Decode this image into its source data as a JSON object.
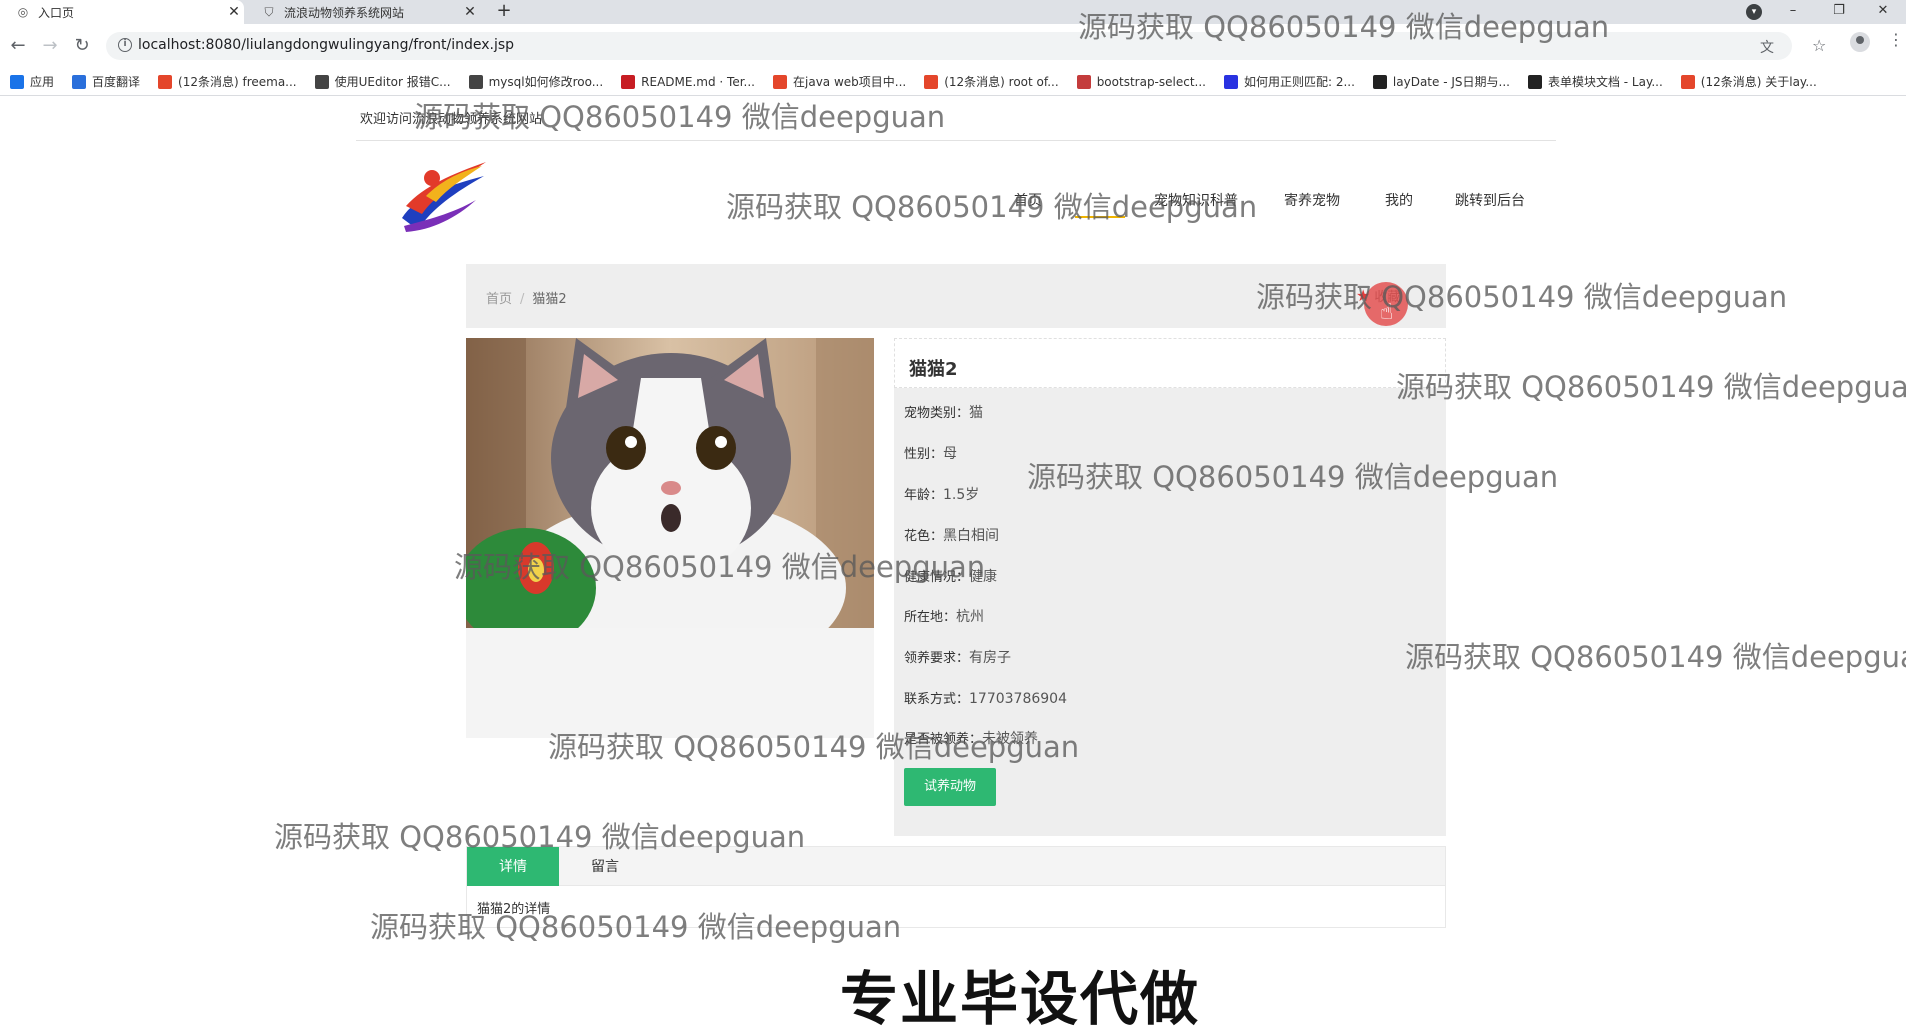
{
  "browser": {
    "tabs": [
      {
        "title": "入口页",
        "active": true
      },
      {
        "title": "流浪动物领养系统网站",
        "active": false
      }
    ],
    "url": "localhost:8080/liulangdongwulingyang/front/index.jsp",
    "bookmarks": [
      {
        "label": "应用",
        "icon": "apps-grid-icon",
        "color": "#1a73e8"
      },
      {
        "label": "百度翻译",
        "icon": "translate-icon",
        "color": "#2a6fdb"
      },
      {
        "label": "(12条消息) freema...",
        "icon": "csdn-icon",
        "color": "#e4462b"
      },
      {
        "label": "使用UEditor 报错C...",
        "icon": "ueditor-icon",
        "color": "#444444"
      },
      {
        "label": "mysql如何修改roo...",
        "icon": "mysql-icon",
        "color": "#444444"
      },
      {
        "label": "README.md · Ter...",
        "icon": "gitee-icon",
        "color": "#c71d23"
      },
      {
        "label": "在java web项目中...",
        "icon": "csdn-icon",
        "color": "#e4462b"
      },
      {
        "label": "(12条消息) root of...",
        "icon": "csdn-icon",
        "color": "#e4462b"
      },
      {
        "label": "bootstrap-select...",
        "icon": "bootstrap-icon",
        "color": "#c43c3c"
      },
      {
        "label": "如何用正则匹配: 2...",
        "icon": "baidu-icon",
        "color": "#2932e1"
      },
      {
        "label": "layDate - JS日期与...",
        "icon": "layui-icon",
        "color": "#222222"
      },
      {
        "label": "表单模块文档 - Lay...",
        "icon": "layui-icon",
        "color": "#222222"
      },
      {
        "label": "(12条消息) 关于lay...",
        "icon": "csdn-icon",
        "color": "#e4462b"
      }
    ]
  },
  "site": {
    "welcome": "欢迎访问流浪动物领养系统网站",
    "nav": [
      {
        "label": "首页"
      },
      {
        "label": "宠物知识科普"
      },
      {
        "label": "寄养宠物"
      },
      {
        "label": "我的"
      },
      {
        "label": "跳转到后台"
      }
    ],
    "breadcrumb": {
      "home": "首页",
      "separator": "/",
      "current": "猫猫2"
    },
    "collect": {
      "label": "收藏",
      "icon": "star-icon"
    },
    "pet": {
      "name": "猫猫2",
      "fields": [
        {
          "key": "宠物类别：",
          "value": "猫"
        },
        {
          "key": "性别：",
          "value": "母"
        },
        {
          "key": "年龄：",
          "value": "1.5岁"
        },
        {
          "key": "花色：",
          "value": "黑白相间"
        },
        {
          "key": "健康情况：",
          "value": "健康"
        },
        {
          "key": "所在地：",
          "value": "杭州"
        },
        {
          "key": "领养要求：",
          "value": "有房子"
        },
        {
          "key": "联系方式：",
          "value": "17703786904"
        },
        {
          "key": "是否被领养：",
          "value": "未被领养"
        }
      ],
      "adopt_button": "试养动物"
    },
    "tabs": [
      {
        "label": "详情",
        "active": true
      },
      {
        "label": "留言",
        "active": false
      }
    ],
    "detail_text": "猫猫2的详情"
  },
  "overlay": {
    "watermark": "源码获取 QQ86050149 微信deepguan",
    "banner": "专业毕设代做"
  },
  "colors": {
    "accent_green": "#2eb872",
    "nav_underline": "#f0b400",
    "collect_red": "#e23c3c"
  }
}
